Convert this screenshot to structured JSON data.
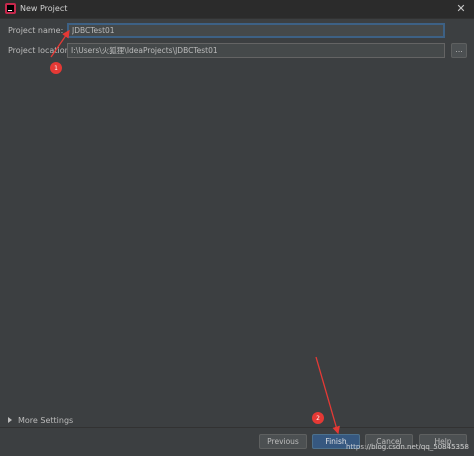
{
  "window": {
    "title": "New Project",
    "close_glyph": "✕"
  },
  "form": {
    "name_label": "Project name:",
    "name_value": "JDBCTest01",
    "location_label": "Project location:",
    "location_value": "I:\\Users\\火狐狸\\IdeaProjects\\JDBCTest01",
    "browse_label": "..."
  },
  "more_settings_label": "More Settings",
  "buttons": {
    "previous": "Previous",
    "finish": "Finish",
    "cancel": "Cancel",
    "help": "Help"
  },
  "annotations": {
    "badge1": "1",
    "badge2": "2",
    "color": "#e53935"
  },
  "watermark": "https://blog.csdn.net/qq_50845358",
  "icons": {
    "app_logo": "intellij-logo-icon",
    "close": "close-icon",
    "expand": "chevron-right-icon"
  }
}
